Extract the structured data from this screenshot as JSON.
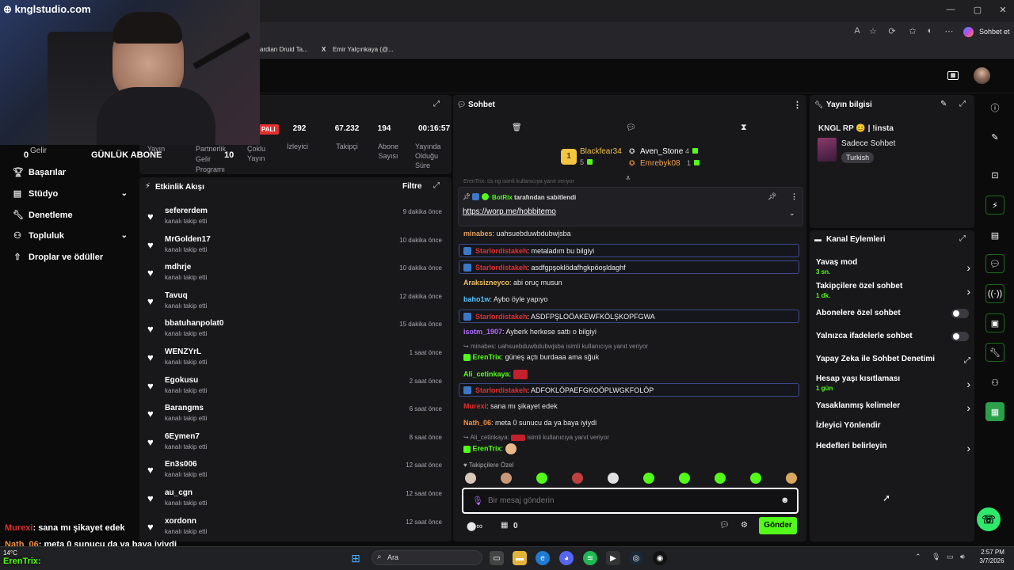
{
  "browser": {
    "tabs_bookmarks": [
      "ardian Druid Ta...",
      "Emir Yalçınkaya (@..."
    ],
    "copilot_label": "Sohbet et",
    "window_controls": [
      "—",
      "▢",
      "✕"
    ]
  },
  "overlay": {
    "site": "knglstudio.com",
    "daily_sub_label": "GÜNLÜK ABONE",
    "daily_sub_value": "10",
    "zero_value": "0",
    "partial_label": "Gelir",
    "chat_overlay": [
      {
        "user": "Murexi",
        "text": ": sana mı şikayet edek"
      },
      {
        "user": "Nath_06",
        "text": ": meta 0 sunucu da ya baya iyiydi"
      },
      {
        "user": "ErenTrix",
        "text": ":"
      }
    ],
    "weather": "14°C"
  },
  "stats": {
    "live_badge": "PALI",
    "items": [
      {
        "value": "292",
        "label": "İzleyici"
      },
      {
        "value": "67.232",
        "label": "Takipçi"
      },
      {
        "value": "194",
        "label": "Abone\nSayısı"
      },
      {
        "value": "00:16:57",
        "label": "Yayında\nOlduğu\nSüre"
      }
    ],
    "labels_row": [
      "Yayın",
      "Partnerlik Gelir Programı",
      "Çoklu Yayın"
    ]
  },
  "left_nav": [
    {
      "label": "Başarılar",
      "icon": "trophy-icon",
      "chevron": false
    },
    {
      "label": "Stüdyo",
      "icon": "studio-icon",
      "chevron": true
    },
    {
      "label": "Denetleme",
      "icon": "wrench-icon",
      "chevron": false
    },
    {
      "label": "Topluluk",
      "icon": "community-icon",
      "chevron": true
    },
    {
      "label": "Droplar ve ödüller",
      "icon": "drops-icon",
      "chevron": false
    }
  ],
  "activity": {
    "title": "Etkinlik Akışı",
    "filter_label": "Filtre",
    "items": [
      {
        "name": "sefererdem",
        "sub": "kanalı takip etti",
        "time": "9 dakika önce"
      },
      {
        "name": "MrGolden17",
        "sub": "kanalı takip etti",
        "time": "10 dakika önce"
      },
      {
        "name": "mdhrje",
        "sub": "kanalı takip etti",
        "time": "10 dakika önce"
      },
      {
        "name": "Tavuq",
        "sub": "kanalı takip etti",
        "time": "12 dakika önce"
      },
      {
        "name": "bbatuhanpolat0",
        "sub": "kanalı takip etti",
        "time": "15 dakika önce"
      },
      {
        "name": "WENZYrL",
        "sub": "kanalı takip etti",
        "time": "1 saat önce"
      },
      {
        "name": "Egokusu",
        "sub": "kanalı takip etti",
        "time": "2 saat önce"
      },
      {
        "name": "Barangms",
        "sub": "kanalı takip etti",
        "time": "6 saat önce"
      },
      {
        "name": "6Eymen7",
        "sub": "kanalı takip etti",
        "time": "8 saat önce"
      },
      {
        "name": "En3s006",
        "sub": "kanalı takip etti",
        "time": "12 saat önce"
      },
      {
        "name": "au_cgn",
        "sub": "kanalı takip etti",
        "time": "12 saat önce"
      },
      {
        "name": "xordonn",
        "sub": "kanalı takip etti",
        "time": "12 saat önce"
      }
    ]
  },
  "chat": {
    "title": "Sohbet",
    "top_gifters": [
      {
        "name": "Blackfear34",
        "count": "5"
      },
      {
        "name": "Aven_Stone",
        "count": "4"
      },
      {
        "name": "Emrebyk08",
        "count": "1"
      }
    ],
    "pinned_by": "BotRix",
    "pinned_suffix": "tarafından sabitlendi",
    "pinned_link": "https://worp.me/hobbitemo",
    "faded_line": "ErenTrix: üs ng isimli kullanıcıya yanıt veriyor",
    "messages": [
      {
        "user": "minabes",
        "color": "#e0a060",
        "text": "uahsuebduwbdubwjsba",
        "boxed": false
      },
      {
        "user": "Starlordistakeh",
        "color": "#e03030",
        "text": "metaladım bu bilgiyi",
        "boxed": true
      },
      {
        "user": "Starlordistakeh",
        "color": "#e03030",
        "text": "asdfgpşoklödafhgkpöoşldaghf",
        "boxed": true
      },
      {
        "user": "Araksizneyco",
        "color": "#f0c060",
        "text": "abi oruç musun",
        "boxed": false
      },
      {
        "user": "baho1w",
        "color": "#56c6ff",
        "text": "Aybo öyle yapıyo",
        "boxed": false
      },
      {
        "user": "Starlordistakeh",
        "color": "#e03030",
        "text": "ASDFPŞLOÖAKEWFKÖLŞKOPFGWA",
        "boxed": true
      },
      {
        "user": "isotm_1907",
        "color": "#b06cff",
        "text": "Ayberk herkese sattı o bilgiyi",
        "boxed": false
      }
    ],
    "reply1": "minabes: uahsuebduwbdubwjsba isimli kullanıcıya yanıt veriyor",
    "msg_eren1_user": "ErenTrix",
    "msg_eren1_text": "güneş açtı burdaaa ama sğuk",
    "msg_ali_user": "Ali_cetinkaya",
    "msg_box4_user": "Starlordistakeh",
    "msg_box4_text": "ADFOKLÖPAEFGKOÖPLWGKFOLÖP",
    "msg_murexi_user": "Murexi",
    "msg_murexi_text": "sana mı şikayet edek",
    "msg_nath_user": "Nath_06",
    "msg_nath_text": "meta 0 sunucu da ya baya iyiydi",
    "reply2_user": "Ali_cetinkaya:",
    "reply2_text": "isimli kullanıcıya yanıt veriyor",
    "msg_eren2_user": "ErenTrix",
    "followers_only": "Takipçilere Özel",
    "input_placeholder": "Bir mesaj gönderin",
    "points_value": "0",
    "send_label": "Gönder"
  },
  "stream_info": {
    "title": "Yayın bilgisi",
    "stream_title": "KNGL RP 😊 | !insta",
    "category": "Sadece Sohbet",
    "tag": "Turkish"
  },
  "channel_actions": {
    "title": "Kanal Eylemleri",
    "rows": [
      {
        "label": "Yavaş mod",
        "sub": "3 sn.",
        "control": "chevron"
      },
      {
        "label": "Takipçilere özel sohbet",
        "sub": "1 dk.",
        "control": "chevron"
      },
      {
        "label": "Abonelere özel sohbet",
        "sub": "",
        "control": "toggle"
      },
      {
        "label": "Yalnızca ifadelerle sohbet",
        "sub": "",
        "control": "toggle"
      },
      {
        "label": "Yapay Zeka ile Sohbet Denetimi",
        "sub": "",
        "control": "external"
      },
      {
        "label": "Hesap yaşı kısıtlaması",
        "sub": "1 gün",
        "control": "chevron"
      },
      {
        "label": "Yasaklanmış kelimeler",
        "sub": "",
        "control": "chevron"
      },
      {
        "label": "İzleyici Yönlendir",
        "sub": "",
        "control": "none"
      },
      {
        "label": "Hedefleri belirleyin",
        "sub": "",
        "control": "chevron"
      }
    ]
  },
  "taskbar": {
    "search": "Ara",
    "time": "2:57 PM",
    "date": "3/7/2026"
  }
}
